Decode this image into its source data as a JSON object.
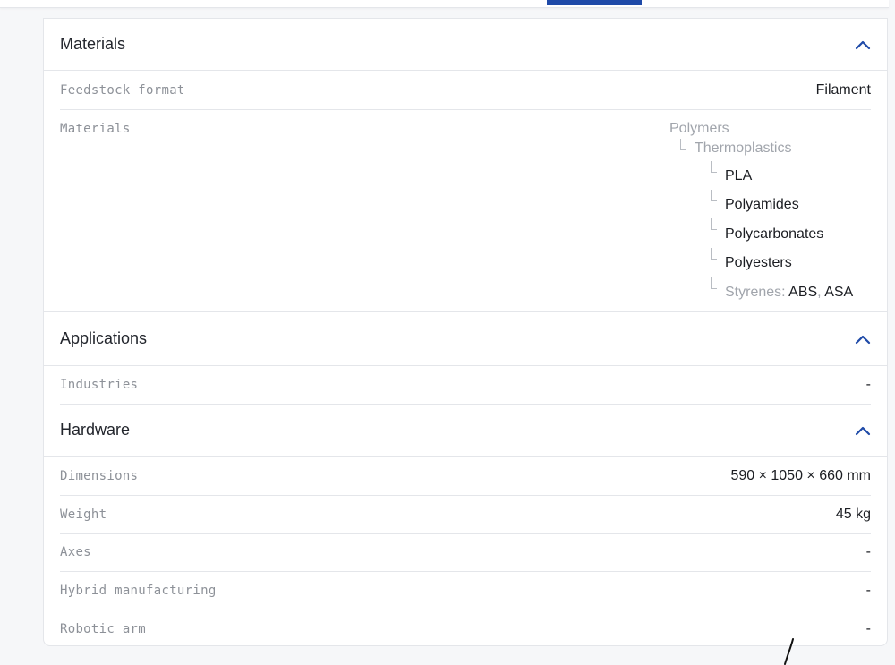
{
  "materials_section": {
    "title": "Materials",
    "rows": [
      {
        "key": "Feedstock format",
        "value": "Filament"
      }
    ],
    "materials_key": "Materials",
    "tree": {
      "root": "Polymers",
      "child": "Thermoplastics",
      "leaves": [
        "PLA",
        "Polyamides",
        "Polycarbonates",
        "Polyesters"
      ],
      "styrenes_label": "Styrenes:",
      "styrenes_items": [
        "ABS",
        "ASA"
      ],
      "styrenes_separator": ","
    }
  },
  "applications_section": {
    "title": "Applications",
    "rows": [
      {
        "key": "Industries",
        "value": "-"
      }
    ]
  },
  "hardware_section": {
    "title": "Hardware",
    "rows": [
      {
        "key": "Dimensions",
        "value": "590 × 1050 × 660 mm"
      },
      {
        "key": "Weight",
        "value": "45 kg"
      },
      {
        "key": "Axes",
        "value": "-"
      },
      {
        "key": "Hybrid manufacturing",
        "value": "-"
      },
      {
        "key": "Robotic arm",
        "value": "-"
      }
    ]
  },
  "icons": {
    "collapse": "chevron-up-icon"
  },
  "colors": {
    "accent": "#1f4aa8",
    "muted_text": "#8d9198",
    "divider": "#e4e6ea"
  }
}
